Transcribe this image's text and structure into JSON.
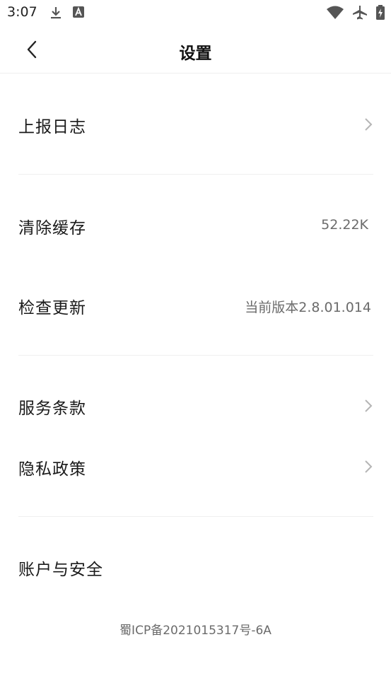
{
  "status_bar": {
    "time": "3:07",
    "left_icons": [
      "download-icon",
      "font-a-icon"
    ],
    "right_icons": [
      "wifi-icon",
      "airplane-icon",
      "battery-charging-icon"
    ]
  },
  "header": {
    "title": "设置",
    "back_icon": "chevron-left-icon"
  },
  "settings": {
    "report_log": {
      "label": "上报日志"
    },
    "clear_cache": {
      "label": "清除缓存",
      "value": "52.22K"
    },
    "check_update": {
      "label": "检查更新",
      "value": "当前版本2.8.01.014"
    },
    "terms": {
      "label": "服务条款"
    },
    "privacy": {
      "label": "隐私政策"
    },
    "account": {
      "label": "账户与安全"
    }
  },
  "footer": {
    "icp": "蜀ICP备2021015317号-6A"
  },
  "colors": {
    "text_primary": "#1a1a1a",
    "text_secondary": "#6b6b6b",
    "divider": "#efefef",
    "chevron": "#b5b5b5"
  }
}
